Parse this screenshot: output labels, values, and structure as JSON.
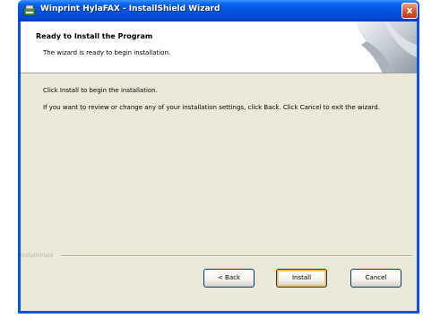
{
  "window": {
    "title": "Winprint HylaFAX - InstallShield Wizard",
    "close_label": "x"
  },
  "header": {
    "title": "Ready to Install the Program",
    "subtitle": "The wizard is ready to begin installation."
  },
  "body": {
    "line1": "Click Install to begin the installation.",
    "line2": "If you want to review or change any of your installation settings, click Back. Click Cancel to exit the wizard."
  },
  "footer": {
    "brand": "InstallShield"
  },
  "buttons": {
    "back": "< Back",
    "install": "Install",
    "cancel": "Cancel"
  },
  "colors": {
    "titlebar": "#0553e0",
    "window_bg": "#ece9d8",
    "close": "#d9542e"
  },
  "icons": {
    "title": "installer-icon",
    "header": "wizard-graphic"
  }
}
